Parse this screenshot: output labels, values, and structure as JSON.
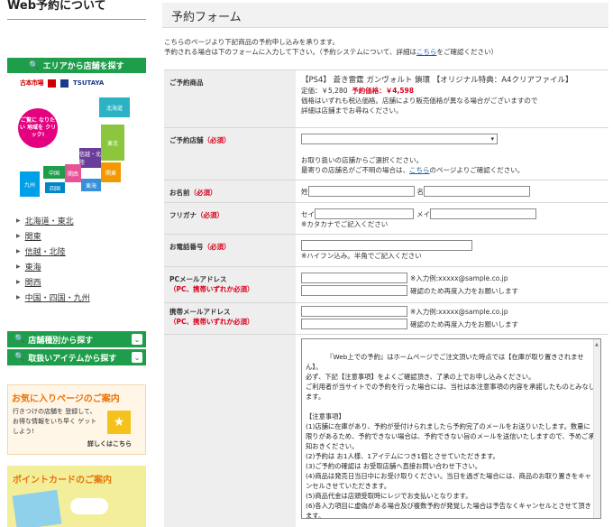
{
  "sidebar": {
    "title": "Web予約について",
    "area_search": "エリアから店舗を探す",
    "logo_left": "古本市場",
    "logo_right": "TSUTAYA",
    "map": {
      "bubble": "ご覧に なりたい 地域を クリック!",
      "regions": [
        "北海道",
        "東北",
        "信越・北陸",
        "関東",
        "中国",
        "関西",
        "東海",
        "九州",
        "四国"
      ]
    },
    "region_links": [
      "北海道・東北",
      "関東",
      "信越・北陸",
      "東海",
      "関西",
      "中国・四国・九州"
    ],
    "shop_type_button": "店舗種別から探す",
    "item_button": "取扱いアイテムから探す",
    "favorites": {
      "title": "お気に入りページのご案内",
      "text": "行きつけの店舗を 登録して、 お得な情報をいち早く ゲットしよう!",
      "more": "詳しくはこちら"
    },
    "point_card": {
      "title": "ポイントカードのご案内"
    }
  },
  "main": {
    "title": "予約フォーム",
    "intro_line1": "こちらのページより下記商品の予約申し込みを承ります。",
    "intro_line2_a": "予約される場合は下のフォームに入力して下さい。（予約システムについて、詳細は",
    "intro_link": "こちら",
    "intro_line2_b": "をご確認ください）",
    "form": {
      "product": {
        "label": "ご予約商品",
        "name": "【PS4】 蒼き雷霆 ガンヴォルト 鎖環 【オリジナル特典：A4クリアファイル】",
        "list_price": "定価：￥5,280",
        "sale_price": "予約価格：￥4,598",
        "note1": "価格はいずれも税込価格。店舗により販売価格が異なる場合がございますので",
        "note2": "詳細は店舗までお尋ねください。"
      },
      "store": {
        "label": "ご予約店舗",
        "required": "（必須）",
        "select_value": "",
        "note1": "お取り扱いの店舗からご選択ください。",
        "note2_a": "最寄りの店舗名がご不明の場合は、",
        "note2_link": "こちら",
        "note2_b": "のページよりご確認ください。"
      },
      "name": {
        "label": "お名前",
        "required": "（必須）",
        "sei": "姓",
        "mei": "名",
        "sei_value": "",
        "mei_value": ""
      },
      "kana": {
        "label": "フリガナ",
        "required": "（必須）",
        "sei": "セイ",
        "mei": "メイ",
        "note": "※カタカナでご記入ください"
      },
      "phone": {
        "label": "お電話番号",
        "required": "（必須）",
        "note": "※ハイフン込み。半角でご記入ください"
      },
      "pc_mail": {
        "label": "PCメールアドレス",
        "required_note": "（PC、携帯いずれか必須）",
        "example": "※入力例:xxxxx@sample.co.jp",
        "confirm": "確認のため再度入力をお願いします"
      },
      "mobile_mail": {
        "label": "携帯メールアドレス",
        "required_note": "（PC、携帯いずれか必須）",
        "example": "※入力例:xxxxx@sample.co.jp",
        "confirm": "確認のため再度入力をお願いします"
      },
      "terms_text": "『Web上での予約』はホームページでご注文頂いた時点では【在庫が取り置きされません】。\n必ず、下記【注意事項】をよくご確認頂き、了承の上でお申し込みください。\nご利用者が当サイトでの予約を行った場合には、当社は本注意事項の内容を承諾したものとみなします。\n\n【注意事項】\n(1)店舗に在庫があり、予約が受付けられましたら予約完了のメールをお送りいたします。数量に限りがあるため、予約できない場合は、予約できない旨のメールを送信いたしますので、予めご承知おきください。\n(2)予約は お1人様、1アイテムにつき1個とさせていただきます。\n(3)ご予約の確認は お受取店舗へ直接お問い合わせ下さい。\n(4)商品は発売日当日中にお受け取りください。当日を過ぎた場合には、商品のお取り置きをキャンセルさせていただきます。\n(5)商品代金は店頭受取時にレジでお支払いとなります。\n(6)各入力項目に虚偽がある場合及び複数予約が発覚した場合は予告なくキャンセルとさせて頂きます。\n(7)転売目的の場合及び業者購入の場合は販売時にお断りさせて頂きますので予めご了承の上お申し込みください。"
    }
  }
}
